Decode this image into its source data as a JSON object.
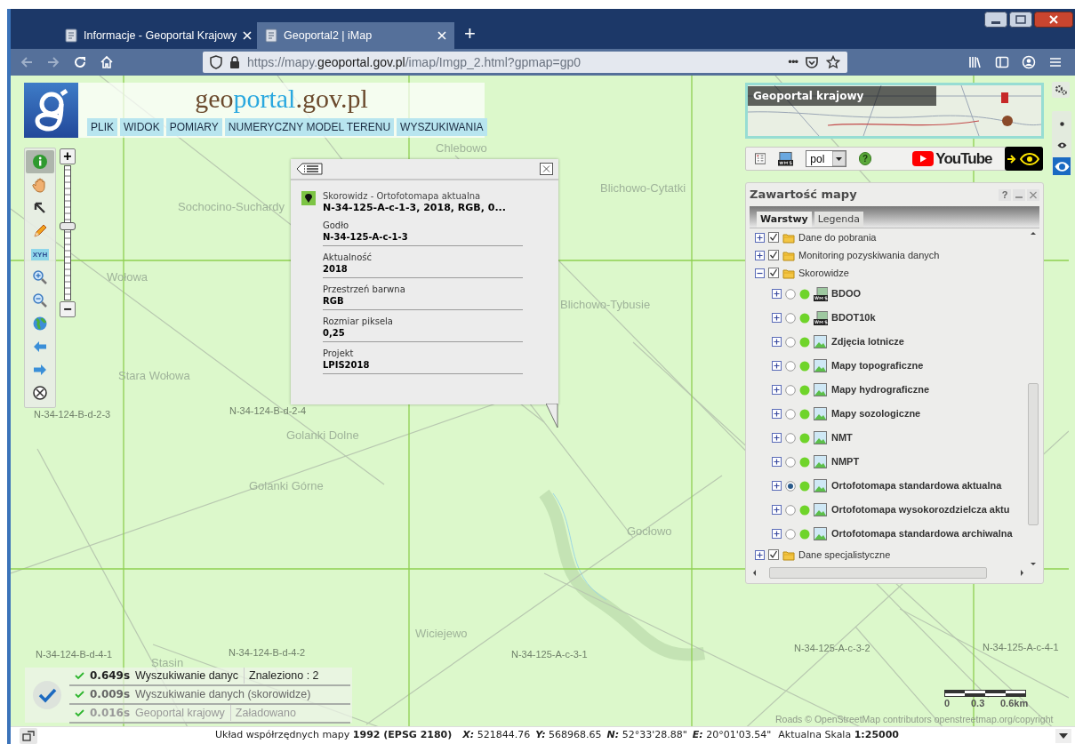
{
  "browser": {
    "tabs": [
      {
        "title": "Informacje - Geoportal Krajowy",
        "selected": false
      },
      {
        "title": "Geoportal2 | iMap",
        "selected": true
      }
    ],
    "new_tab": "+",
    "url": {
      "prefix": "https://mapy.",
      "domain": "geoportal.gov.pl",
      "path": "/imap/Imgp_2.html?gpmap=gp0"
    },
    "page_actions": "•••"
  },
  "header": {
    "logo_text": [
      "geo",
      "portal",
      ".gov.pl"
    ],
    "menu": [
      "PLIK",
      "WIDOK",
      "POMIARY",
      "NUMERYCZNY MODEL TERENU",
      "WYSZUKIWANIA"
    ]
  },
  "tools": [
    {
      "kind": "info",
      "selected": true
    },
    {
      "kind": "pan",
      "selected": false
    },
    {
      "kind": "select",
      "selected": false
    },
    {
      "kind": "draw",
      "selected": false
    },
    {
      "kind": "xyh",
      "selected": false,
      "label": "XYH"
    },
    {
      "kind": "zoom_in",
      "selected": false
    },
    {
      "kind": "zoom_out",
      "selected": false
    },
    {
      "kind": "globe",
      "selected": false
    },
    {
      "kind": "back",
      "selected": false
    },
    {
      "kind": "forward",
      "selected": false
    },
    {
      "kind": "clear",
      "selected": false
    }
  ],
  "zoom": {
    "plus": "+",
    "minus": "−",
    "level": 0.55
  },
  "popup": {
    "layer": "Skorowidz - Ortofotomapa aktualna",
    "summary": "N-34-125-A-c-1-3, 2018, RGB, 0...",
    "fields": [
      {
        "label": "Godło",
        "value": "N-34-125-A-c-1-3"
      },
      {
        "label": "Aktualność",
        "value": "2018"
      },
      {
        "label": "Przestrzeń barwna",
        "value": "RGB"
      },
      {
        "label": "Rozmiar piksela",
        "value": "0,25"
      },
      {
        "label": "Projekt",
        "value": "LPIS2018"
      }
    ]
  },
  "overview": {
    "title": "Geoportal krajowy"
  },
  "eye_sizes": [
    {
      "kind": "dot",
      "selected": false
    },
    {
      "kind": "eye",
      "selected": false
    },
    {
      "kind": "eye_large",
      "selected": true
    }
  ],
  "map_toolbar": {
    "language": "pol",
    "help": "?",
    "youtube": "YouTube"
  },
  "layers_panel": {
    "title": "Zawartość mapy",
    "help": "?",
    "tabs": [
      {
        "label": "Warstwy",
        "selected": true
      },
      {
        "label": "Legenda",
        "selected": false
      }
    ],
    "tree": [
      {
        "label": "Dane do pobrania",
        "checked": true,
        "expanded": false
      },
      {
        "label": "Monitoring pozyskiwania danych",
        "checked": true,
        "expanded": false
      },
      {
        "label": "Skorowidze",
        "checked": true,
        "expanded": true,
        "children": [
          {
            "label": "BDOO",
            "kind": "wms",
            "selected": false
          },
          {
            "label": "BDOT10k",
            "kind": "wms",
            "selected": false
          },
          {
            "label": "Zdjęcia lotnicze",
            "kind": "image",
            "selected": false
          },
          {
            "label": "Mapy topograficzne",
            "kind": "image",
            "selected": false
          },
          {
            "label": "Mapy hydrograficzne",
            "kind": "image",
            "selected": false
          },
          {
            "label": "Mapy sozologiczne",
            "kind": "image",
            "selected": false
          },
          {
            "label": "NMT",
            "kind": "image",
            "selected": false
          },
          {
            "label": "NMPT",
            "kind": "image",
            "selected": false
          },
          {
            "label": "Ortofotomapa standardowa aktualna",
            "kind": "image",
            "selected": true
          },
          {
            "label": "Ortofotomapa wysokorozdzielcza aktu",
            "kind": "image",
            "selected": false
          },
          {
            "label": "Ortofotomapa standardowa archiwalna",
            "kind": "image",
            "selected": false
          }
        ]
      },
      {
        "label": "Dane specjalistyczne",
        "checked": true,
        "expanded": false
      }
    ]
  },
  "status_log": [
    {
      "time": "0.649s",
      "texts": [
        "Wyszukiwanie danyc",
        "Znaleziono : 2"
      ]
    },
    {
      "time": "0.009s",
      "texts": [
        "Wyszukiwanie danych (skorowidze)"
      ]
    },
    {
      "time": "0.016s",
      "texts": [
        "Geoportal krajowy",
        "Załadowano"
      ]
    }
  ],
  "map_labels": [
    {
      "kind": "place",
      "text": "Chlebowo"
    },
    {
      "kind": "place",
      "text": "Sochocino-Suchardy"
    },
    {
      "kind": "place",
      "text": "Blichowo-Cytatki"
    },
    {
      "kind": "place",
      "text": "Wołowa"
    },
    {
      "kind": "place",
      "text": "Blichowo-Tybusie"
    },
    {
      "kind": "place",
      "text": "Stara Wołowa"
    },
    {
      "kind": "sheet",
      "text": "N-34-124-B-d-2-3"
    },
    {
      "kind": "sheet",
      "text": "N-34-124-B-d-2-4"
    },
    {
      "kind": "place",
      "text": "Golanki Dolne"
    },
    {
      "kind": "place",
      "text": "Golanki Górne"
    },
    {
      "kind": "place",
      "text": "Gocłowo"
    },
    {
      "kind": "place",
      "text": "Wiciejewo"
    },
    {
      "kind": "sheet",
      "text": "N-34-124-B-d-4-1"
    },
    {
      "kind": "sheet",
      "text": "N-34-124-B-d-4-2"
    },
    {
      "kind": "place",
      "text": "Stasin"
    },
    {
      "kind": "sheet",
      "text": "N-34-125-A-c-3-1"
    },
    {
      "kind": "sheet",
      "text": "N-34-125-A-c-3-2"
    },
    {
      "kind": "sheet",
      "text": "N-34-125-A-c-4-1"
    }
  ],
  "scale": {
    "labels": [
      "0",
      "0.3",
      "0.6km"
    ]
  },
  "attribution": "Roads © OpenStreetMap contributors openstreetmap.org/copyright",
  "status_bar": {
    "coordinate_system": "Układ współrzędnych mapy **1992 (EPSG 2180)**",
    "coordinates": [
      {
        "axis": "X:",
        "value": "521844.76"
      },
      {
        "axis": "Y:",
        "value": "568968.65"
      },
      {
        "axis": "N:",
        "value": "52°33'28.88\""
      },
      {
        "axis": "E:",
        "value": "20°01'03.54\""
      }
    ],
    "scale": "Aktualna Skala **1:25000**"
  }
}
